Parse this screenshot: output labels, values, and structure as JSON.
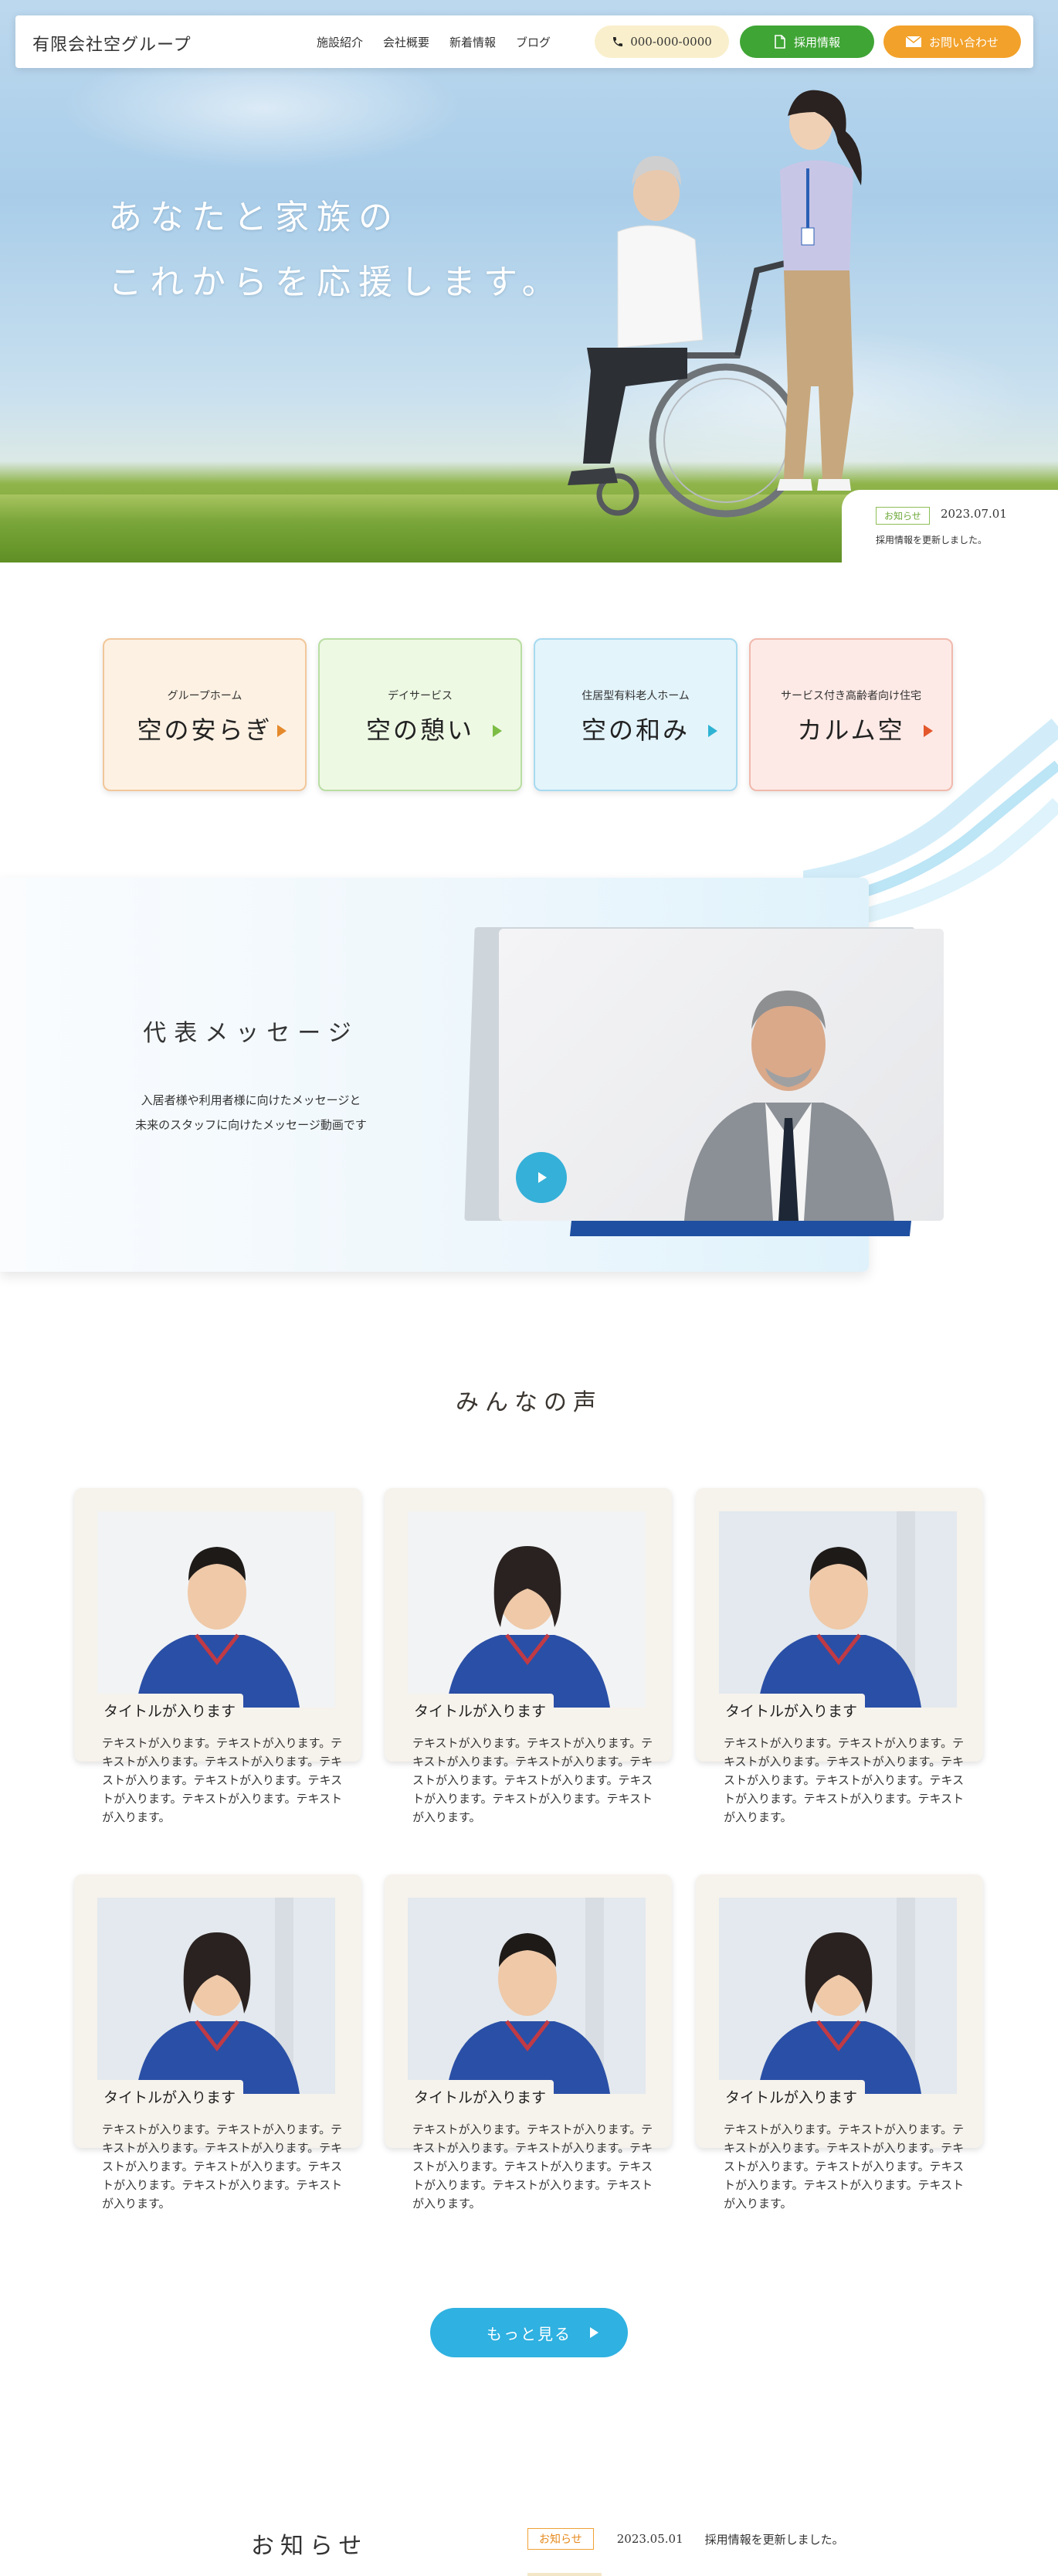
{
  "header": {
    "logo": "有限会社空グループ",
    "nav": [
      "施設紹介",
      "会社概要",
      "新着情報",
      "ブログ"
    ],
    "tel": "000-000-0000",
    "recruit": "採用情報",
    "contact": "お問い合わせ"
  },
  "hero": {
    "line1": "あなたと家族の",
    "line2": "これからを応援します。",
    "news": {
      "tag": "お知らせ",
      "date": "2023.07.01",
      "text": "採用情報を更新しました。"
    }
  },
  "facilities": [
    {
      "category": "グループホーム",
      "name": "空の安らぎ",
      "bg": "#fdf1e3",
      "border": "#f1c79a",
      "arrow": "#e58a2c"
    },
    {
      "category": "デイサービス",
      "name": "空の憩い",
      "bg": "#eef9e4",
      "border": "#b9dea2",
      "arrow": "#7dbd45"
    },
    {
      "category": "住居型有料老人ホーム",
      "name": "空の和み",
      "bg": "#e3f4fb",
      "border": "#a7daf0",
      "arrow": "#2fb3d3"
    },
    {
      "category": "サービス付き高齢者向け住宅",
      "name": "カルム空",
      "bg": "#fdeae6",
      "border": "#f1b9ad",
      "arrow": "#e3572b"
    }
  ],
  "message": {
    "title": "代表メッセージ",
    "line1": "入居者様や利用者様に向けたメッセージと",
    "line2": "未来のスタッフに向けたメッセージ動画です"
  },
  "voices": {
    "title": "みんなの声",
    "cards": [
      {
        "title": "タイトルが入ります",
        "text": "テキストが入ります。テキストが入ります。テキストが入ります。テキストが入ります。テキストが入ります。テキストが入ります。テキストが入ります。テキストが入ります。テキストが入ります。",
        "person": "male"
      },
      {
        "title": "タイトルが入ります",
        "text": "テキストが入ります。テキストが入ります。テキストが入ります。テキストが入ります。テキストが入ります。テキストが入ります。テキストが入ります。テキストが入ります。テキストが入ります。",
        "person": "female"
      },
      {
        "title": "タイトルが入ります",
        "text": "テキストが入ります。テキストが入ります。テキストが入ります。テキストが入ります。テキストが入ります。テキストが入ります。テキストが入ります。テキストが入ります。テキストが入ります。",
        "person": "male"
      },
      {
        "title": "タイトルが入ります",
        "text": "テキストが入ります。テキストが入ります。テキストが入ります。テキストが入ります。テキストが入ります。テキストが入ります。テキストが入ります。テキストが入ります。テキストが入ります。",
        "person": "female"
      },
      {
        "title": "タイトルが入ります",
        "text": "テキストが入ります。テキストが入ります。テキストが入ります。テキストが入ります。テキストが入ります。テキストが入ります。テキストが入ります。テキストが入ります。テキストが入ります。",
        "person": "male"
      },
      {
        "title": "タイトルが入ります",
        "text": "テキストが入ります。テキストが入ります。テキストが入ります。テキストが入ります。テキストが入ります。テキストが入ります。テキストが入ります。テキストが入ります。テキストが入ります。",
        "person": "female"
      }
    ],
    "more": "もっと見る"
  },
  "news": {
    "title": "お知らせ",
    "tag": "お知らせ",
    "date": "2023.05.01",
    "text": "採用情報を更新しました。"
  },
  "colors": {
    "recruit": "#3fa535",
    "contact": "#f2a12a",
    "tel_bg": "#f9efcc",
    "accent_blue": "#2fb1e1"
  }
}
